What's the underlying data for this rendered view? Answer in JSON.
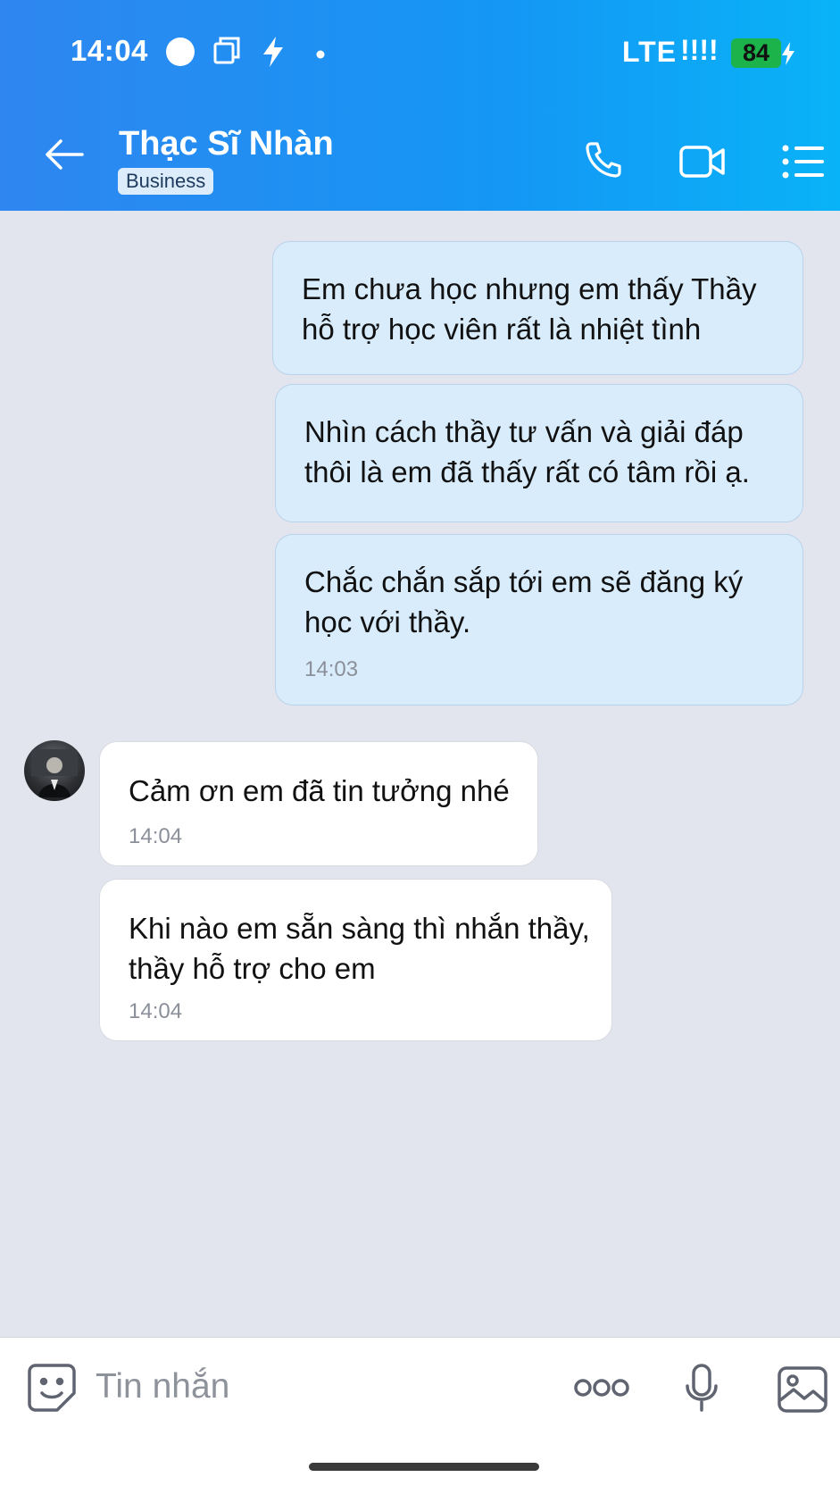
{
  "status_bar": {
    "time": "14:04",
    "network": "LTE",
    "signal": "!!!!",
    "battery": "84"
  },
  "header": {
    "contact_name": "Thạc Sĩ Nhàn",
    "badge": "Business"
  },
  "messages": [
    {
      "direction": "out",
      "text": "Em chưa học nhưng em thấy Thầy hỗ trợ học viên rất là nhiệt tình",
      "time": ""
    },
    {
      "direction": "out",
      "text": "Nhìn cách thầy tư vấn và giải đáp thôi là em đã thấy rất có tâm rồi ạ.",
      "time": ""
    },
    {
      "direction": "out",
      "text": "Chắc chắn sắp tới em sẽ đăng ký học với thầy.",
      "time": "14:03"
    },
    {
      "direction": "in",
      "text": "Cảm ơn em đã tin tưởng nhé",
      "time": "14:04"
    },
    {
      "direction": "in",
      "text": "Khi nào em sẵn sàng thì nhắn thầy, thầy hỗ trợ cho em",
      "time": "14:04"
    }
  ],
  "composer": {
    "placeholder": "Tin nhắn"
  },
  "icons": {
    "back": "arrow-left-icon",
    "call": "phone-icon",
    "video": "video-camera-icon",
    "menu": "list-menu-icon",
    "emoji": "sticker-face-icon",
    "more": "more-dots-icon",
    "mic": "microphone-icon",
    "image": "image-icon"
  },
  "colors": {
    "header_start": "#2f86f0",
    "header_end": "#09b3f7",
    "outgoing_bubble": "#d8ecfc",
    "incoming_bubble": "#ffffff",
    "battery": "#1bb34a"
  }
}
